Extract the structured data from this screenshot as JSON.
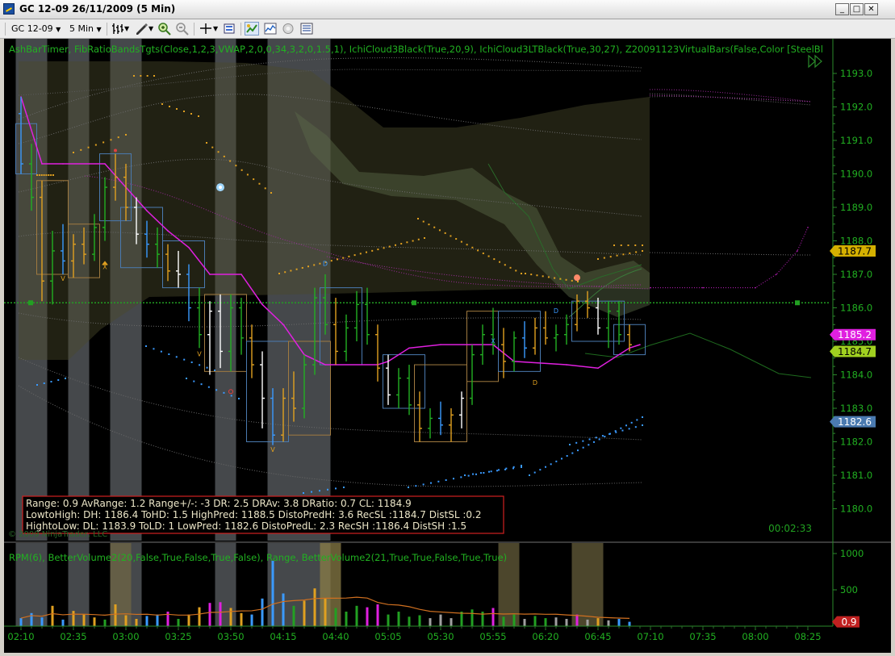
{
  "window": {
    "title": "GC 12-09  26/11/2009 (5 Min)",
    "buttons": {
      "minimize": "_",
      "maximize": "□",
      "close": "✕"
    }
  },
  "toolbar": {
    "instrument": "GC 12-09",
    "interval": "5 Min",
    "icons": [
      "bar-type-icon",
      "drawing-tool-icon",
      "zoom-in-icon",
      "zoom-out-icon",
      "crosshair-icon",
      "properties-icon",
      "strategies-icon",
      "indicators-icon",
      "data-box-icon",
      "chart-trader-icon"
    ]
  },
  "price_panel": {
    "indicator_label": "AshBarTimer,  FibRatioBandsTgts(Close,1,2,3,VWAP,2,0,0,34,3,2,0,1.5,1),  IchiCloud3Black(True,20,9),  IchiCloud3LTBlack(True,30,27),  Z20091123VirtualBars(False,Color  [SteelBl",
    "copyright": "© 2009 NinjaTrader, LLC",
    "bar_timer": "00:02:33",
    "price_axis_labels": [
      "1193.0",
      "1192.0",
      "1191.0",
      "1190.0",
      "1189.0",
      "1188.0",
      "1187.0",
      "1186.0",
      "1185.0",
      "1184.0",
      "1183.0",
      "1182.0",
      "1181.0",
      "1180.0"
    ],
    "price_tags": [
      {
        "label": "1187.7",
        "value": 1187.7,
        "color": "#d4b000"
      },
      {
        "label": "1185.2",
        "value": 1185.2,
        "color": "#e020e0"
      },
      {
        "label": "1184.7",
        "value": 1184.7,
        "color": "#a0d020"
      },
      {
        "label": "1182.6",
        "value": 1182.6,
        "color": "#4a7ab0"
      }
    ],
    "stats": {
      "line1": "Range:  0.9   AvRange:  1.2   Range+/-:  -3  DR:  2.5  DRAv:  3.8  DRatio:  0.7  CL:  1184.9",
      "line2": "LowtoHigh:      DH:  1186.4  ToHD:  1.5  HighPred:  1188.5  DistoPredH:  3.6  RecSL  :1184.7  DistSL  :0.2",
      "line3": "HightoLow:      DL:  1183.9  ToLD:  1  LowPred:    1182.6  DistoPredL:  2.3  RecSH  :1186.4  DistSH  :1.5"
    }
  },
  "volume_panel": {
    "indicator_label": "RPM(6),   BetterVolume2(20,False,True,False,True,False),    Range,    BetterVolume2(21,True,True,False,True,True)",
    "axis_labels": [
      "1000",
      "500"
    ],
    "value_tag": "0.9"
  },
  "time_axis": [
    "02:10",
    "02:35",
    "03:00",
    "03:25",
    "03:50",
    "04:15",
    "04:40",
    "05:05",
    "05:30",
    "05:55",
    "06:20",
    "06:45",
    "07:10",
    "07:35",
    "08:00",
    "08:25"
  ],
  "chart_data": {
    "type": "candlestick",
    "instrument": "GC 12-09",
    "interval": "5 Min",
    "date": "26/11/2009",
    "ylim": [
      1180.0,
      1193.0
    ],
    "vertical_range_bands": [
      {
        "name": "B1",
        "from": "02:10",
        "to": "02:20",
        "color": "#8a8f95"
      },
      {
        "name": "B2",
        "from": "02:35",
        "to": "02:40",
        "color": "#8a8f95"
      },
      {
        "name": "B3",
        "from": "02:55",
        "to": "03:05",
        "color": "#8a8f95"
      },
      {
        "name": "B4",
        "from": "03:45",
        "to": "03:50",
        "color": "#8a8f95"
      },
      {
        "name": "B5",
        "from": "04:10",
        "to": "04:35",
        "color": "#8a8f95"
      }
    ],
    "candles": [
      {
        "t": "02:10",
        "o": 1191.8,
        "h": 1192.3,
        "l": 1190.0,
        "c": 1190.3
      },
      {
        "t": "02:15",
        "o": 1190.3,
        "h": 1190.9,
        "l": 1188.9,
        "c": 1189.3
      },
      {
        "t": "02:20",
        "o": 1189.3,
        "h": 1189.8,
        "l": 1186.2,
        "c": 1186.8
      },
      {
        "t": "02:25",
        "o": 1186.8,
        "h": 1188.3,
        "l": 1186.1,
        "c": 1187.7
      },
      {
        "t": "02:30",
        "o": 1187.7,
        "h": 1188.5,
        "l": 1187.0,
        "c": 1187.4
      },
      {
        "t": "02:35",
        "o": 1187.4,
        "h": 1188.2,
        "l": 1186.9,
        "c": 1187.9
      },
      {
        "t": "02:40",
        "o": 1187.9,
        "h": 1188.4,
        "l": 1187.3,
        "c": 1187.6
      },
      {
        "t": "02:45",
        "o": 1187.6,
        "h": 1188.8,
        "l": 1187.4,
        "c": 1188.4
      },
      {
        "t": "02:50",
        "o": 1188.4,
        "h": 1189.9,
        "l": 1188.0,
        "c": 1189.6
      },
      {
        "t": "02:55",
        "o": 1189.6,
        "h": 1190.6,
        "l": 1189.2,
        "c": 1189.9
      },
      {
        "t": "03:00",
        "o": 1189.9,
        "h": 1190.3,
        "l": 1188.6,
        "c": 1189.0
      },
      {
        "t": "03:05",
        "o": 1189.0,
        "h": 1189.3,
        "l": 1187.9,
        "c": 1188.2
      },
      {
        "t": "03:10",
        "o": 1188.2,
        "h": 1188.6,
        "l": 1187.5,
        "c": 1187.9
      },
      {
        "t": "03:15",
        "o": 1187.9,
        "h": 1188.4,
        "l": 1187.2,
        "c": 1187.6
      },
      {
        "t": "03:20",
        "o": 1187.6,
        "h": 1187.9,
        "l": 1186.8,
        "c": 1187.1
      },
      {
        "t": "03:25",
        "o": 1187.1,
        "h": 1187.7,
        "l": 1186.6,
        "c": 1187.0
      },
      {
        "t": "03:30",
        "o": 1187.0,
        "h": 1187.3,
        "l": 1185.6,
        "c": 1186.0
      },
      {
        "t": "03:35",
        "o": 1186.0,
        "h": 1186.6,
        "l": 1184.8,
        "c": 1185.2
      },
      {
        "t": "03:40",
        "o": 1185.2,
        "h": 1186.2,
        "l": 1184.0,
        "c": 1185.9
      },
      {
        "t": "03:45",
        "o": 1185.9,
        "h": 1186.4,
        "l": 1184.2,
        "c": 1184.7
      },
      {
        "t": "03:50",
        "o": 1184.7,
        "h": 1186.4,
        "l": 1184.1,
        "c": 1186.0
      },
      {
        "t": "03:55",
        "o": 1186.0,
        "h": 1186.3,
        "l": 1184.6,
        "c": 1185.1
      },
      {
        "t": "04:00",
        "o": 1185.1,
        "h": 1185.5,
        "l": 1183.9,
        "c": 1184.3
      },
      {
        "t": "04:05",
        "o": 1184.3,
        "h": 1184.7,
        "l": 1182.4,
        "c": 1183.3
      },
      {
        "t": "04:10",
        "o": 1183.3,
        "h": 1183.6,
        "l": 1181.9,
        "c": 1182.2
      },
      {
        "t": "04:15",
        "o": 1182.2,
        "h": 1183.6,
        "l": 1182.0,
        "c": 1183.3
      },
      {
        "t": "04:20",
        "o": 1183.3,
        "h": 1184.1,
        "l": 1182.6,
        "c": 1183.0
      },
      {
        "t": "04:25",
        "o": 1183.0,
        "h": 1184.6,
        "l": 1182.7,
        "c": 1184.3
      },
      {
        "t": "04:30",
        "o": 1184.3,
        "h": 1186.6,
        "l": 1184.0,
        "c": 1186.3
      },
      {
        "t": "04:35",
        "o": 1186.3,
        "h": 1187.0,
        "l": 1185.2,
        "c": 1185.5
      },
      {
        "t": "04:40",
        "o": 1185.5,
        "h": 1186.3,
        "l": 1184.3,
        "c": 1184.7
      },
      {
        "t": "04:45",
        "o": 1184.7,
        "h": 1185.8,
        "l": 1184.4,
        "c": 1185.4
      },
      {
        "t": "04:50",
        "o": 1185.4,
        "h": 1186.5,
        "l": 1185.0,
        "c": 1186.1
      },
      {
        "t": "04:55",
        "o": 1186.1,
        "h": 1186.6,
        "l": 1184.9,
        "c": 1185.2
      },
      {
        "t": "05:00",
        "o": 1185.2,
        "h": 1185.5,
        "l": 1183.8,
        "c": 1184.2
      },
      {
        "t": "05:05",
        "o": 1184.2,
        "h": 1184.6,
        "l": 1183.1,
        "c": 1183.4
      },
      {
        "t": "05:10",
        "o": 1183.4,
        "h": 1184.2,
        "l": 1183.0,
        "c": 1183.9
      },
      {
        "t": "05:15",
        "o": 1183.9,
        "h": 1184.3,
        "l": 1182.8,
        "c": 1183.1
      },
      {
        "t": "05:20",
        "o": 1183.1,
        "h": 1183.5,
        "l": 1182.0,
        "c": 1182.4
      },
      {
        "t": "05:25",
        "o": 1182.4,
        "h": 1183.0,
        "l": 1182.1,
        "c": 1182.7
      },
      {
        "t": "05:30",
        "o": 1182.7,
        "h": 1183.2,
        "l": 1182.2,
        "c": 1182.5
      },
      {
        "t": "05:35",
        "o": 1182.5,
        "h": 1183.0,
        "l": 1182.0,
        "c": 1182.8
      },
      {
        "t": "05:40",
        "o": 1182.8,
        "h": 1183.5,
        "l": 1182.4,
        "c": 1183.3
      },
      {
        "t": "05:45",
        "o": 1183.3,
        "h": 1184.9,
        "l": 1183.1,
        "c": 1184.6
      },
      {
        "t": "05:50",
        "o": 1184.6,
        "h": 1185.5,
        "l": 1184.3,
        "c": 1185.2
      },
      {
        "t": "05:55",
        "o": 1185.2,
        "h": 1186.0,
        "l": 1184.6,
        "c": 1184.9
      },
      {
        "t": "06:00",
        "o": 1184.9,
        "h": 1185.4,
        "l": 1183.9,
        "c": 1184.4
      },
      {
        "t": "06:05",
        "o": 1184.4,
        "h": 1185.3,
        "l": 1184.1,
        "c": 1185.1
      },
      {
        "t": "06:10",
        "o": 1185.1,
        "h": 1185.6,
        "l": 1184.5,
        "c": 1184.8
      },
      {
        "t": "06:15",
        "o": 1184.8,
        "h": 1185.7,
        "l": 1184.6,
        "c": 1185.4
      },
      {
        "t": "06:20",
        "o": 1185.4,
        "h": 1185.9,
        "l": 1184.9,
        "c": 1185.1
      },
      {
        "t": "06:25",
        "o": 1185.1,
        "h": 1185.5,
        "l": 1184.7,
        "c": 1185.2
      },
      {
        "t": "06:30",
        "o": 1185.2,
        "h": 1185.8,
        "l": 1184.9,
        "c": 1185.5
      },
      {
        "t": "06:35",
        "o": 1185.5,
        "h": 1186.4,
        "l": 1185.3,
        "c": 1186.2
      },
      {
        "t": "06:40",
        "o": 1186.2,
        "h": 1186.5,
        "l": 1185.7,
        "c": 1186.0
      },
      {
        "t": "06:45",
        "o": 1186.0,
        "h": 1186.3,
        "l": 1185.2,
        "c": 1185.4
      },
      {
        "t": "06:50",
        "o": 1185.4,
        "h": 1186.2,
        "l": 1184.8,
        "c": 1185.9
      },
      {
        "t": "06:55",
        "o": 1185.9,
        "h": 1186.2,
        "l": 1184.9,
        "c": 1185.2
      },
      {
        "t": "07:00",
        "o": 1185.2,
        "h": 1185.5,
        "l": 1184.7,
        "c": 1184.9
      }
    ],
    "vwap_line": [
      {
        "t": "02:10",
        "v": 1192.3
      },
      {
        "t": "02:20",
        "v": 1190.3
      },
      {
        "t": "02:30",
        "v": 1190.3
      },
      {
        "t": "02:50",
        "v": 1190.3
      },
      {
        "t": "03:00",
        "v": 1189.6
      },
      {
        "t": "03:10",
        "v": 1188.9
      },
      {
        "t": "03:20",
        "v": 1188.3
      },
      {
        "t": "03:30",
        "v": 1187.8
      },
      {
        "t": "03:40",
        "v": 1187.0
      },
      {
        "t": "03:55",
        "v": 1187.0
      },
      {
        "t": "04:05",
        "v": 1186.1
      },
      {
        "t": "04:15",
        "v": 1185.5
      },
      {
        "t": "04:25",
        "v": 1184.6
      },
      {
        "t": "04:35",
        "v": 1184.3
      },
      {
        "t": "05:00",
        "v": 1184.3
      },
      {
        "t": "05:05",
        "v": 1184.4
      },
      {
        "t": "05:15",
        "v": 1184.8
      },
      {
        "t": "05:30",
        "v": 1184.9
      },
      {
        "t": "05:55",
        "v": 1184.9
      },
      {
        "t": "06:05",
        "v": 1184.4
      },
      {
        "t": "06:30",
        "v": 1184.3
      },
      {
        "t": "06:45",
        "v": 1184.2
      },
      {
        "t": "07:00",
        "v": 1184.8
      },
      {
        "t": "07:05",
        "v": 1184.9
      }
    ],
    "projection_line": [
      {
        "t": "07:10",
        "v": 1186.6
      },
      {
        "t": "07:35",
        "v": 1186.6
      },
      {
        "t": "08:00",
        "v": 1186.6
      },
      {
        "t": "08:10",
        "v": 1187.0
      },
      {
        "t": "08:20",
        "v": 1187.7
      },
      {
        "t": "08:25",
        "v": 1188.4
      }
    ],
    "horizontal_level": {
      "value": 1186.15,
      "color": "#22a022"
    },
    "volume": [
      {
        "t": "02:10",
        "v": 110,
        "c": "#3a9aff"
      },
      {
        "t": "02:15",
        "v": 180,
        "c": "#3a9aff"
      },
      {
        "t": "02:20",
        "v": 120,
        "c": "#3a9aff"
      },
      {
        "t": "02:25",
        "v": 280,
        "c": "#e0a020"
      },
      {
        "t": "02:30",
        "v": 90,
        "c": "#3a9aff"
      },
      {
        "t": "02:35",
        "v": 210,
        "c": "#e0a020"
      },
      {
        "t": "02:40",
        "v": 160,
        "c": "#e0a020"
      },
      {
        "t": "02:45",
        "v": 120,
        "c": "#e0a020"
      },
      {
        "t": "02:50",
        "v": 90,
        "c": "#22a022"
      },
      {
        "t": "02:55",
        "v": 300,
        "c": "#e0a020"
      },
      {
        "t": "03:00",
        "v": 150,
        "c": "#e0a020"
      },
      {
        "t": "03:05",
        "v": 100,
        "c": "#e0a020"
      },
      {
        "t": "03:10",
        "v": 140,
        "c": "#3a9aff"
      },
      {
        "t": "03:15",
        "v": 160,
        "c": "#3a9aff"
      },
      {
        "t": "03:20",
        "v": 200,
        "c": "#e020e0"
      },
      {
        "t": "03:25",
        "v": 100,
        "c": "#22a022"
      },
      {
        "t": "03:30",
        "v": 160,
        "c": "#e0a020"
      },
      {
        "t": "03:35",
        "v": 260,
        "c": "#e0a020"
      },
      {
        "t": "03:40",
        "v": 320,
        "c": "#e020e0"
      },
      {
        "t": "03:45",
        "v": 330,
        "c": "#e020e0"
      },
      {
        "t": "03:50",
        "v": 250,
        "c": "#e0a020"
      },
      {
        "t": "03:55",
        "v": 180,
        "c": "#e0a020"
      },
      {
        "t": "04:00",
        "v": 160,
        "c": "#3a9aff"
      },
      {
        "t": "04:05",
        "v": 380,
        "c": "#3a9aff"
      },
      {
        "t": "04:10",
        "v": 900,
        "c": "#3a9aff"
      },
      {
        "t": "04:15",
        "v": 450,
        "c": "#3a9aff"
      },
      {
        "t": "04:20",
        "v": 280,
        "c": "#22a022"
      },
      {
        "t": "04:25",
        "v": 350,
        "c": "#e0a020"
      },
      {
        "t": "04:30",
        "v": 520,
        "c": "#e0a020"
      },
      {
        "t": "04:35",
        "v": 380,
        "c": "#e0a020"
      },
      {
        "t": "04:40",
        "v": 250,
        "c": "#22a022"
      },
      {
        "t": "04:45",
        "v": 200,
        "c": "#22a022"
      },
      {
        "t": "04:50",
        "v": 280,
        "c": "#22a022"
      },
      {
        "t": "04:55",
        "v": 260,
        "c": "#e020e0"
      },
      {
        "t": "05:00",
        "v": 300,
        "c": "#e020e0"
      },
      {
        "t": "05:05",
        "v": 160,
        "c": "#22a022"
      },
      {
        "t": "05:10",
        "v": 200,
        "c": "#22a022"
      },
      {
        "t": "05:15",
        "v": 130,
        "c": "#22a022"
      },
      {
        "t": "05:20",
        "v": 150,
        "c": "#22a022"
      },
      {
        "t": "05:25",
        "v": 110,
        "c": "#a0a0a0"
      },
      {
        "t": "05:30",
        "v": 160,
        "c": "#a0a0a0"
      },
      {
        "t": "05:35",
        "v": 110,
        "c": "#a0a0a0"
      },
      {
        "t": "05:40",
        "v": 200,
        "c": "#22a022"
      },
      {
        "t": "05:45",
        "v": 230,
        "c": "#22a022"
      },
      {
        "t": "05:50",
        "v": 200,
        "c": "#22a022"
      },
      {
        "t": "05:55",
        "v": 250,
        "c": "#e020e0"
      },
      {
        "t": "06:00",
        "v": 130,
        "c": "#22a022"
      },
      {
        "t": "06:05",
        "v": 160,
        "c": "#22a022"
      },
      {
        "t": "06:10",
        "v": 100,
        "c": "#a0a0a0"
      },
      {
        "t": "06:15",
        "v": 140,
        "c": "#22a022"
      },
      {
        "t": "06:20",
        "v": 110,
        "c": "#22a022"
      },
      {
        "t": "06:25",
        "v": 120,
        "c": "#a0a0a0"
      },
      {
        "t": "06:30",
        "v": 100,
        "c": "#a0a0a0"
      },
      {
        "t": "06:35",
        "v": 160,
        "c": "#e020e0"
      },
      {
        "t": "06:40",
        "v": 90,
        "c": "#a0a0a0"
      },
      {
        "t": "06:45",
        "v": 110,
        "c": "#e0a020"
      },
      {
        "t": "06:50",
        "v": 80,
        "c": "#a0a0a0"
      },
      {
        "t": "06:55",
        "v": 100,
        "c": "#3a9aff"
      },
      {
        "t": "07:00",
        "v": 60,
        "c": "#3a9aff"
      }
    ]
  }
}
